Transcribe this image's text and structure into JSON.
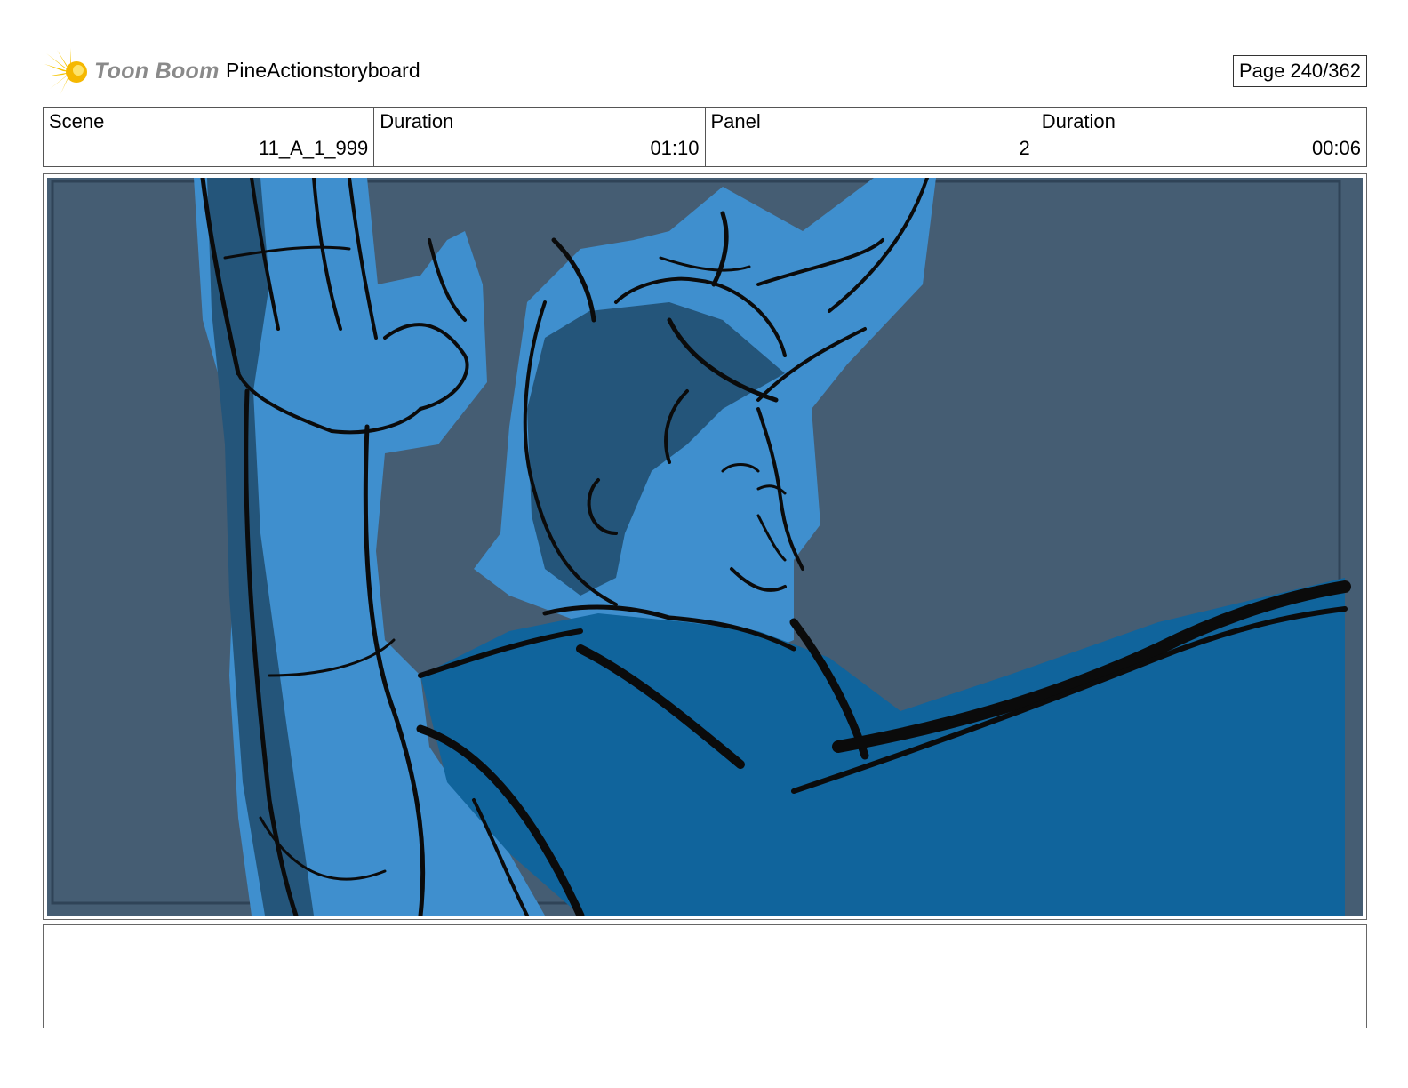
{
  "header": {
    "logo_text": "Toon Boom",
    "project_title": "PineActionstoryboard",
    "page_indicator": "Page 240/362"
  },
  "info": {
    "scene_label": "Scene",
    "scene_value": "11_A_1_999",
    "scene_duration_label": "Duration",
    "scene_duration_value": "01:10",
    "panel_label": "Panel",
    "panel_value": "2",
    "panel_duration_label": "Duration",
    "panel_duration_value": "00:06"
  },
  "notes": {
    "text": ""
  },
  "colors": {
    "background_slate": "#455d73",
    "figure_light_blue": "#3f8fce",
    "figure_dark_blue": "#24557a",
    "shirt_blue": "#10649c",
    "logo_yellow": "#f5c400"
  },
  "icons": {
    "logo": "toon-boom-sunburst-icon"
  }
}
